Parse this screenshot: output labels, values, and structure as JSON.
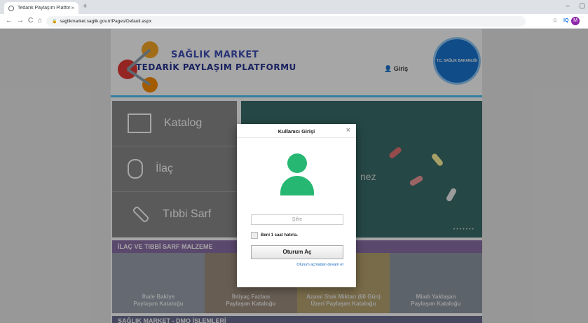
{
  "browser": {
    "tab_title": "Tedarik Paylaşım Platformu",
    "tab_close": "×",
    "new_tab": "+",
    "url": "saglikmarket.saglik.gov.tr/Pages/Default.aspx",
    "back": "←",
    "forward": "→",
    "reload": "C",
    "home": "⌂",
    "star": "☆",
    "ext": "IQ",
    "profile_initial": "M",
    "win_min": "–",
    "win_max": "▢"
  },
  "site": {
    "brand_line1": "SAĞLIK MARKET",
    "brand_line2": "TEDARİK PAYLAŞIM PLATFORMU",
    "login_link": "Giriş",
    "seal_text": "T.C. SAĞLIK BAKANLIĞI",
    "menu": [
      {
        "label": "Katalog"
      },
      {
        "label": "İlaç"
      },
      {
        "label": "Tıbbi Sarf"
      }
    ],
    "banner_text": "nez",
    "banner_dots": "•••••••",
    "section_title": "İLAÇ VE TIBBİ SARF MALZEME",
    "cards": [
      {
        "line1": "İhale Bakiye",
        "line2": "Paylaşım Kataloğu"
      },
      {
        "line1": "İhtiyaç Fazlası",
        "line2": "Paylaşım Kataloğu"
      },
      {
        "line1": "Azami Stok Miktarı (60 Gün)",
        "line2": "Üzeri Paylaşım Kataloğu"
      },
      {
        "line1": "Miadı Yaklaşan",
        "line2": "Paylaşım Kataloğu"
      }
    ],
    "bottom_section": "SAĞLIK MARKET - DMO İŞLEMLERİ"
  },
  "modal": {
    "title": "Kullanıcı Girişi",
    "close": "×",
    "password_placeholder": "Şifre",
    "remember_label": "Beni 1 saat hatırla.",
    "login_button": "Oturum Aç",
    "continue_link": "Oturum açmadan devam et"
  }
}
